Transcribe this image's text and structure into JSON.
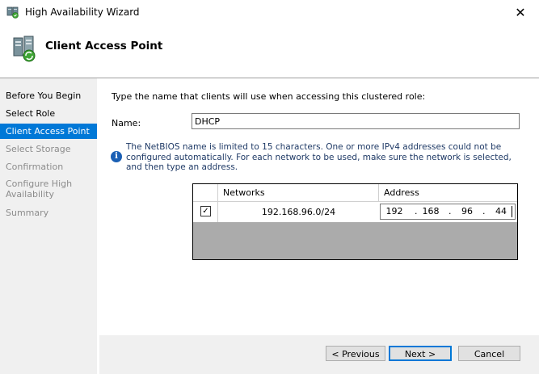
{
  "window": {
    "title": "High Availability Wizard",
    "close_glyph": "✕",
    "app_icon": "cluster-wizard-icon"
  },
  "header": {
    "title": "Client Access Point",
    "icon": "cluster-server-icon"
  },
  "sidebar": {
    "items": [
      {
        "label": "Before You Begin",
        "state": "enabled"
      },
      {
        "label": "Select Role",
        "state": "enabled"
      },
      {
        "label": "Client Access Point",
        "state": "selected"
      },
      {
        "label": "Select Storage",
        "state": "disabled"
      },
      {
        "label": "Confirmation",
        "state": "disabled"
      },
      {
        "label": "Configure High Availability",
        "state": "disabled"
      },
      {
        "label": "Summary",
        "state": "disabled"
      }
    ]
  },
  "main": {
    "prompt": "Type the name that clients will use when accessing this clustered role:",
    "name_label": "Name:",
    "name_value": "DHCP",
    "info_glyph": "i",
    "info_text": "The NetBIOS name is limited to 15 characters.  One or more IPv4 addresses could not be configured automatically.  For each network to be used, make sure the network is selected, and then type an address.",
    "grid": {
      "columns": [
        "Networks",
        "Address"
      ],
      "rows": [
        {
          "checked": true,
          "check_glyph": "✓",
          "network": "192.168.96.0/24",
          "address": [
            "192",
            "168",
            "96",
            "44"
          ]
        }
      ],
      "dot": "."
    }
  },
  "footer": {
    "previous": "< Previous",
    "next": "Next >",
    "cancel": "Cancel"
  },
  "colors": {
    "selection": "#0078d7",
    "sidebar_bg": "#f0f0f0",
    "info_text": "#1f3a66"
  }
}
